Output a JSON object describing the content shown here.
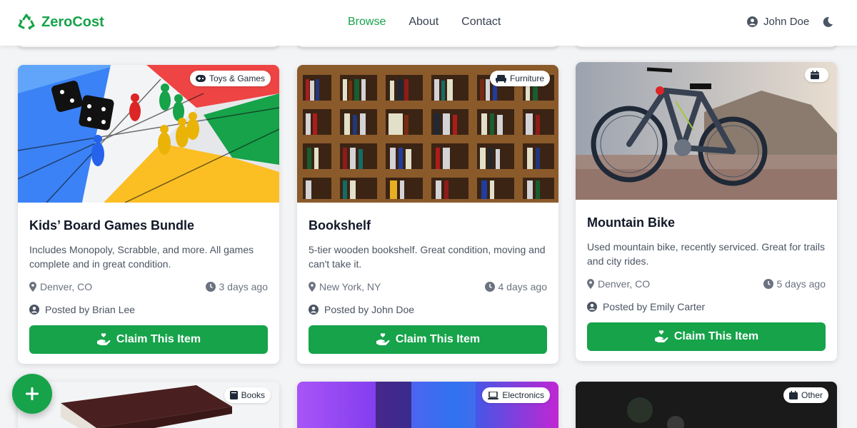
{
  "app": {
    "name": "ZeroCost",
    "brand_color": "#16a34a"
  },
  "nav": {
    "links": [
      {
        "label": "Browse",
        "active": true
      },
      {
        "label": "About",
        "active": false
      },
      {
        "label": "Contact",
        "active": false
      }
    ],
    "user_name": "John Doe",
    "theme_icon": "moon-icon"
  },
  "items": [
    {
      "category": "Toys & Games",
      "category_icon": "gamepad-icon",
      "title": "Kids’ Board Games Bundle",
      "description": "Includes Monopoly, Scrabble, and more. All games complete and in great condition.",
      "location": "Denver, CO",
      "time": "3 days ago",
      "poster": "Posted by Brian Lee",
      "button": "Claim This Item"
    },
    {
      "category": "Furniture",
      "category_icon": "couch-icon",
      "title": "Bookshelf",
      "description": "5-tier wooden bookshelf. Great condition, moving and can't take it.",
      "location": "New York, NY",
      "time": "4 days ago",
      "poster": "Posted by John Doe",
      "button": "Claim This Item"
    },
    {
      "category": "",
      "category_icon": "calendar-icon",
      "title": "Mountain Bike",
      "description": "Used mountain bike, recently serviced. Great for trails and city rides.",
      "location": "Denver, CO",
      "time": "5 days ago",
      "poster": "Posted by Emily Carter",
      "button": "Claim This Item"
    }
  ],
  "bottom_items": [
    {
      "category": "Books",
      "category_icon": "book-icon"
    },
    {
      "category": "Electronics",
      "category_icon": "laptop-icon"
    },
    {
      "category": "Other",
      "category_icon": "box-icon"
    }
  ],
  "fab": {
    "icon": "plus-icon"
  }
}
